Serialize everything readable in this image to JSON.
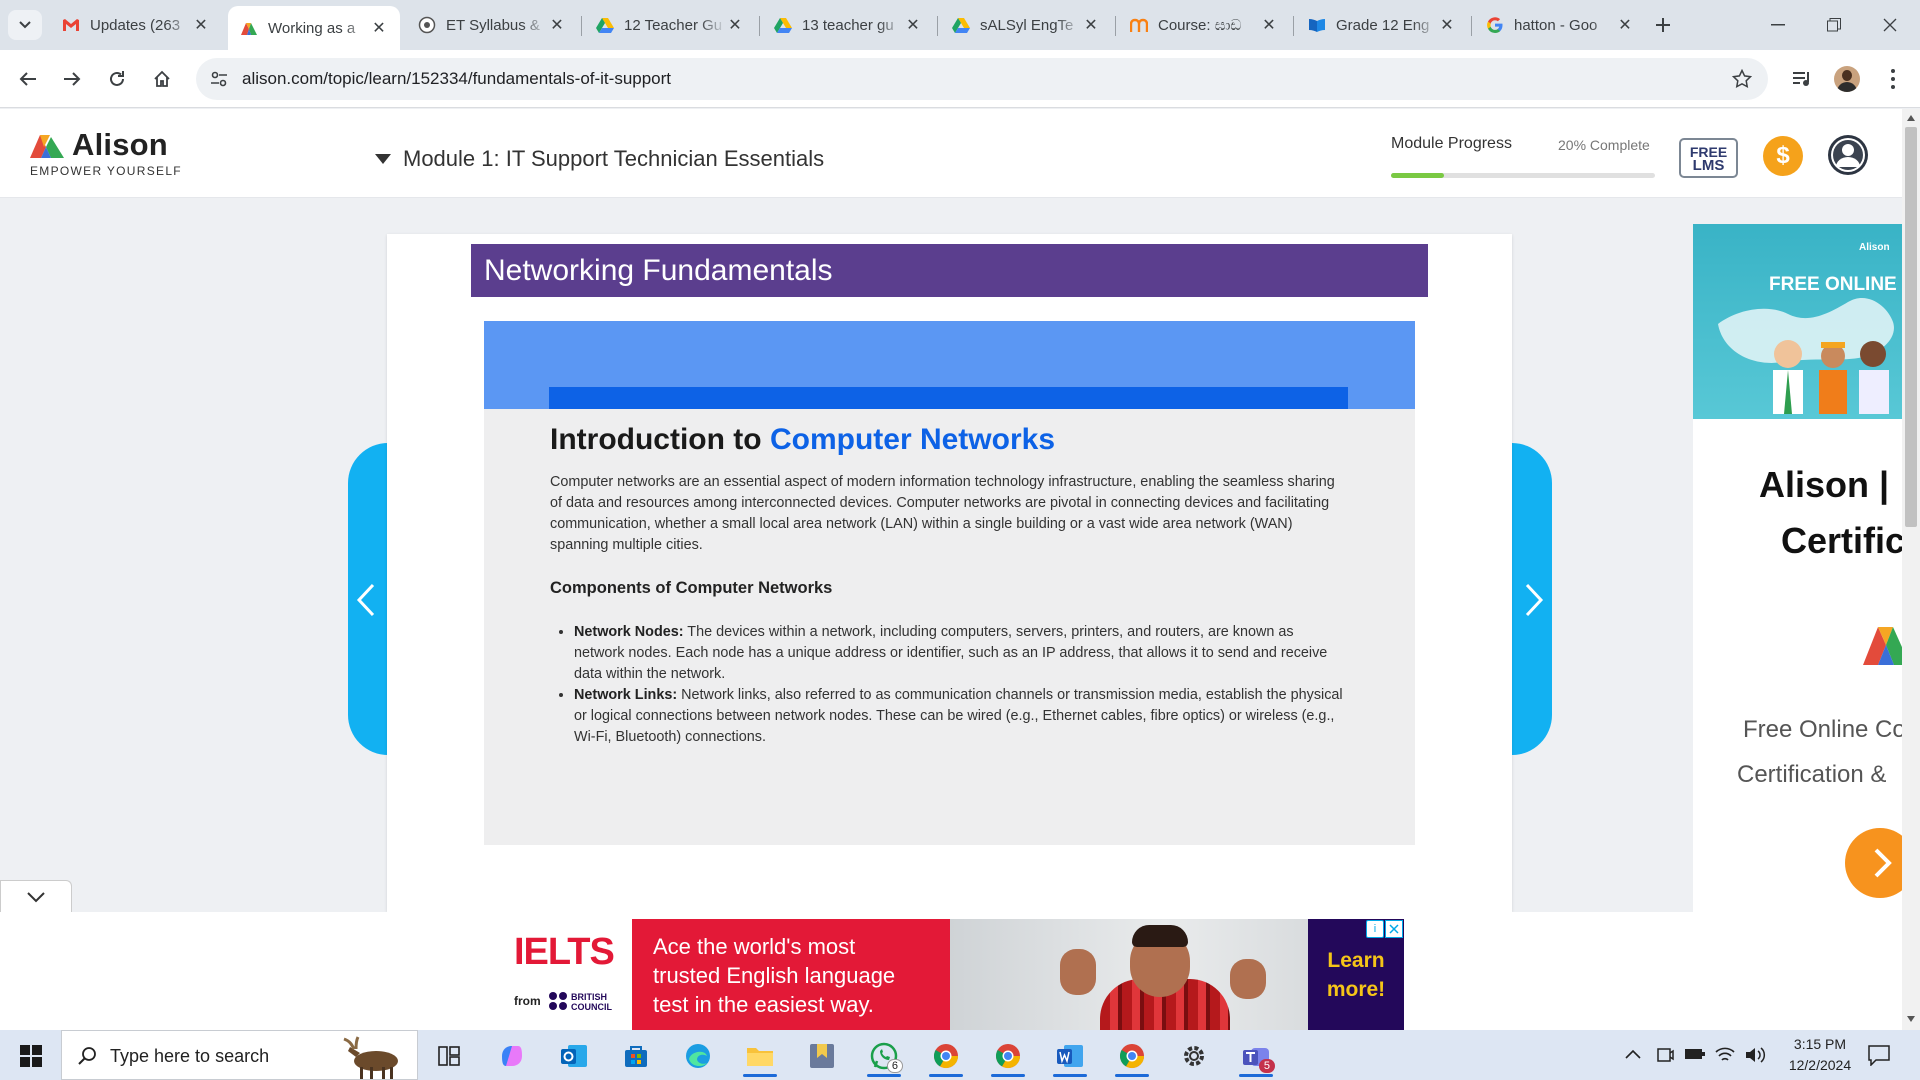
{
  "browser": {
    "tabs": [
      {
        "title": "Updates (263",
        "favicon": "gmail-icon"
      },
      {
        "title": "Working as a",
        "favicon": "alison-icon",
        "active": true
      },
      {
        "title": "ET Syllabus &",
        "favicon": "web-icon"
      },
      {
        "title": "12 Teacher Gu",
        "favicon": "google-drive-icon"
      },
      {
        "title": "13 teacher gu",
        "favicon": "google-drive-icon"
      },
      {
        "title": "sALSyl EngTe",
        "favicon": "google-drive-icon"
      },
      {
        "title": "Course: ඝාඩ",
        "favicon": "moodle-icon"
      },
      {
        "title": "Grade 12 Eng",
        "favicon": "book-icon"
      },
      {
        "title": "hatton - Goo",
        "favicon": "google-icon"
      }
    ],
    "url": "alison.com/topic/learn/152334/fundamentals-of-it-support"
  },
  "site": {
    "logo_name": "Alison",
    "logo_tagline": "EMPOWER YOURSELF",
    "module_title": "Module 1: IT Support Technician Essentials",
    "progress_label": "Module Progress",
    "progress_text": "20% Complete",
    "progress_value": 0.2,
    "lms_badge_line1": "FREE",
    "lms_badge_line2": "LMS",
    "coin_symbol": "$"
  },
  "lesson": {
    "section_title": "Networking Fundamentals",
    "heading_part1": "Introduction to ",
    "heading_part2": "Computer Networks",
    "intro": "Computer networks are an essential aspect of modern information technology infrastructure, enabling the seamless sharing of data and resources among interconnected devices. Computer networks are pivotal in connecting devices and facilitating communication, whether a small local area network (LAN) within a single building or a vast wide area network (WAN) spanning multiple cities.",
    "subheading": "Components of Computer Networks",
    "bullets": [
      {
        "term": "Network Nodes:",
        "text": " The devices within a network, including computers, servers, printers, and routers, are known as network nodes. Each node has a unique address or identifier, such as an IP address, that allows it to send and receive data within the network."
      },
      {
        "term": "Network Links:",
        "text": " Network links, also referred to as communication channels or transmission media, establish the physical or logical connections between network nodes. These can be wired (e.g., Ethernet cables, fibre optics) or wireless (e.g., Wi-Fi, Bluetooth) connections."
      }
    ]
  },
  "side_ad": {
    "banner_brand": "Alison",
    "banner_title": "FREE ONLINE",
    "title_line1": "Alison |",
    "title_line2": "Certific",
    "subtitle_line1": "Free Online Co",
    "subtitle_line2": "Certification &"
  },
  "bottom_ad": {
    "brand": "IELTS",
    "brand_from": "from",
    "council_line1": "BRITISH",
    "council_line2": "COUNCIL",
    "headline": "Ace the world's most trusted English language test in the easiest way.",
    "cta": "Learn more!"
  },
  "taskbar": {
    "search_placeholder": "Type here to search",
    "whatsapp_badge": "6",
    "teams_badge": "5",
    "time": "3:15 PM",
    "date": "12/2/2024"
  },
  "colors": {
    "lesson_bar": "#5b3e8e",
    "accent_blue": "#0d62e6",
    "nav_arrow": "#12b1f2",
    "progress_fill": "#7ac943",
    "ielts_red": "#e31937"
  }
}
